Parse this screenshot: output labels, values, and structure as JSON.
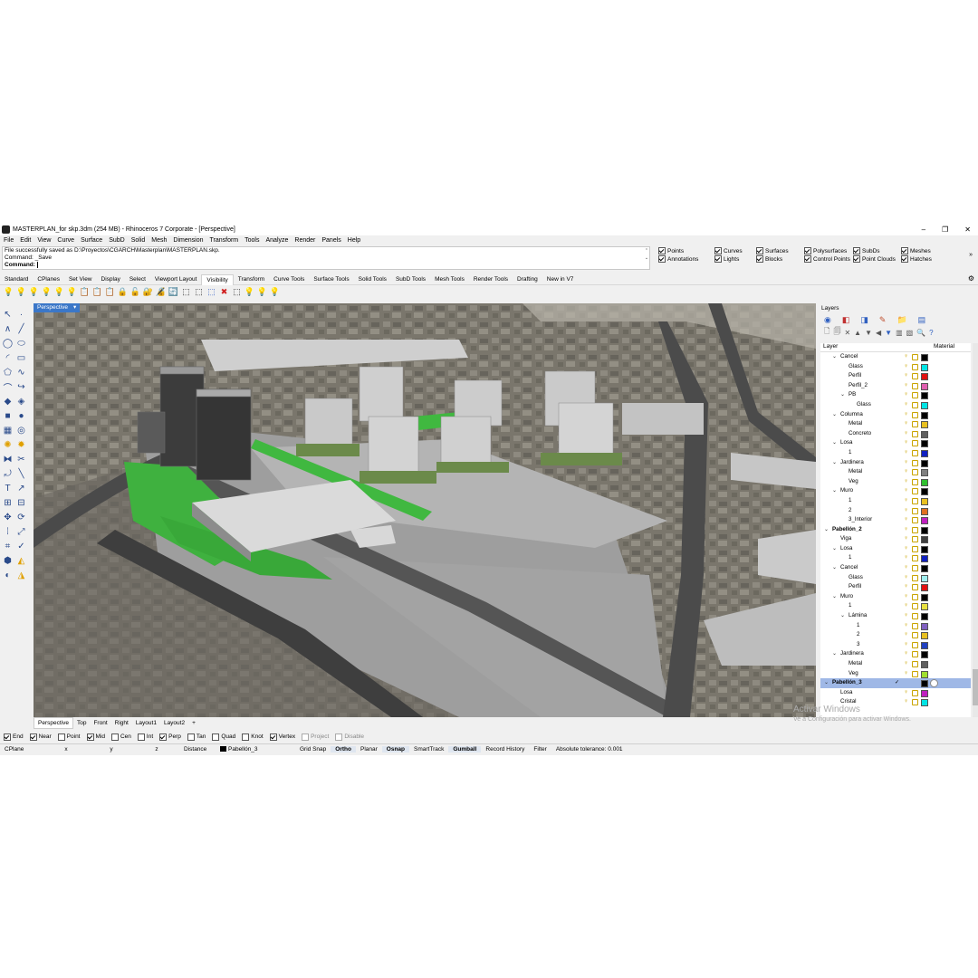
{
  "window": {
    "title": "MASTERPLAN_for skp.3dm (254 MB) - Rhinoceros 7 Corporate - [Perspective]",
    "minimize": "–",
    "maximize": "❐",
    "close": "✕"
  },
  "menu": [
    "File",
    "Edit",
    "View",
    "Curve",
    "Surface",
    "SubD",
    "Solid",
    "Mesh",
    "Dimension",
    "Transform",
    "Tools",
    "Analyze",
    "Render",
    "Panels",
    "Help"
  ],
  "command": {
    "line1": "File successfully saved as D:\\Proyectos\\CGARCH\\Masterplan\\MASTERPLAN.skp.",
    "line2": "Command: _Save",
    "prompt": "Command:"
  },
  "filters": [
    {
      "label": "Points",
      "checked": true
    },
    {
      "label": "Annotations",
      "checked": true
    },
    {
      "label": "Curves",
      "checked": true
    },
    {
      "label": "Lights",
      "checked": true
    },
    {
      "label": "Surfaces",
      "checked": true
    },
    {
      "label": "Blocks",
      "checked": true
    },
    {
      "label": "Polysurfaces",
      "checked": true
    },
    {
      "label": "Control Points",
      "checked": true
    },
    {
      "label": "SubDs",
      "checked": true
    },
    {
      "label": "Point Clouds",
      "checked": true
    },
    {
      "label": "Meshes",
      "checked": true
    },
    {
      "label": "Hatches",
      "checked": true
    }
  ],
  "toolbar_tabs": [
    "Standard",
    "CPlanes",
    "Set View",
    "Display",
    "Select",
    "Viewport Layout",
    "Visibility",
    "Transform",
    "Curve Tools",
    "Surface Tools",
    "Solid Tools",
    "SubD Tools",
    "Mesh Tools",
    "Render Tools",
    "Drafting",
    "New in V7"
  ],
  "active_tab": "Visibility",
  "viewport": {
    "label": "Perspective",
    "dropdown": "▾"
  },
  "viewport_tabs": [
    "Perspective",
    "Top",
    "Front",
    "Right",
    "Layout1",
    "Layout2",
    "+"
  ],
  "osnaps": [
    {
      "label": "End",
      "checked": true
    },
    {
      "label": "Near",
      "checked": true
    },
    {
      "label": "Point",
      "checked": false
    },
    {
      "label": "Mid",
      "checked": true
    },
    {
      "label": "Cen",
      "checked": false
    },
    {
      "label": "Int",
      "checked": false
    },
    {
      "label": "Perp",
      "checked": true
    },
    {
      "label": "Tan",
      "checked": false
    },
    {
      "label": "Quad",
      "checked": false
    },
    {
      "label": "Knot",
      "checked": false
    },
    {
      "label": "Vertex",
      "checked": true
    },
    {
      "label": "Project",
      "checked": false,
      "disabled": true
    },
    {
      "label": "Disable",
      "checked": false,
      "disabled": true
    }
  ],
  "status": {
    "cplane": "CPlane",
    "x": "x",
    "y": "y",
    "z": "z",
    "distance": "Distance",
    "layer": "Pabellón_3",
    "grid_snap": "Grid Snap",
    "ortho": "Ortho",
    "planar": "Planar",
    "osnap": "Osnap",
    "smarttrack": "SmartTrack",
    "gumball": "Gumball",
    "record_history": "Record History",
    "filter": "Filter",
    "tolerance": "Absolute tolerance: 0.001"
  },
  "layers_panel": {
    "title": "Layers",
    "col_layer": "Layer",
    "col_material": "Material",
    "rows": [
      {
        "name": "Cancel",
        "indent": 1,
        "exp": "v",
        "color": "#000000"
      },
      {
        "name": "Glass",
        "indent": 2,
        "exp": "",
        "color": "#00e5e5"
      },
      {
        "name": "Perfil",
        "indent": 2,
        "exp": "",
        "color": "#e01010"
      },
      {
        "name": "Perfil_2",
        "indent": 2,
        "exp": "",
        "color": "#e060b0"
      },
      {
        "name": "PB",
        "indent": 2,
        "exp": "v",
        "color": "#000000"
      },
      {
        "name": "Glass",
        "indent": 3,
        "exp": "",
        "color": "#00e5e5"
      },
      {
        "name": "Columna",
        "indent": 1,
        "exp": "v",
        "color": "#000000"
      },
      {
        "name": "Metal",
        "indent": 2,
        "exp": "",
        "color": "#e8c020"
      },
      {
        "name": "Concreto",
        "indent": 2,
        "exp": "",
        "color": "#606060"
      },
      {
        "name": "Losa",
        "indent": 1,
        "exp": "v",
        "color": "#000000"
      },
      {
        "name": "1",
        "indent": 2,
        "exp": "",
        "color": "#1020c0"
      },
      {
        "name": "Jardinera",
        "indent": 1,
        "exp": "v",
        "color": "#000000"
      },
      {
        "name": "Metal",
        "indent": 2,
        "exp": "",
        "color": "#808080"
      },
      {
        "name": "Veg",
        "indent": 2,
        "exp": "",
        "color": "#30c030"
      },
      {
        "name": "Muro",
        "indent": 1,
        "exp": "v",
        "color": "#000000"
      },
      {
        "name": "1",
        "indent": 2,
        "exp": "",
        "color": "#e8c020"
      },
      {
        "name": "2",
        "indent": 2,
        "exp": "",
        "color": "#e07020"
      },
      {
        "name": "3_Interior",
        "indent": 2,
        "exp": "",
        "color": "#c020c0"
      },
      {
        "name": "Pabellón_2",
        "indent": 0,
        "exp": "v",
        "color": "#000000"
      },
      {
        "name": "Viga",
        "indent": 1,
        "exp": "",
        "color": "#404040"
      },
      {
        "name": "Losa",
        "indent": 1,
        "exp": "v",
        "color": "#000000"
      },
      {
        "name": "1",
        "indent": 2,
        "exp": "",
        "color": "#1020c0"
      },
      {
        "name": "Cancel",
        "indent": 1,
        "exp": "v",
        "color": "#000000"
      },
      {
        "name": "Glass",
        "indent": 2,
        "exp": "",
        "color": "#a0f0f0"
      },
      {
        "name": "Perfil",
        "indent": 2,
        "exp": "",
        "color": "#e01010"
      },
      {
        "name": "Muro",
        "indent": 1,
        "exp": "v",
        "color": "#000000"
      },
      {
        "name": "1",
        "indent": 2,
        "exp": "",
        "color": "#e8e040"
      },
      {
        "name": "Lámina",
        "indent": 2,
        "exp": "v",
        "color": "#000000"
      },
      {
        "name": "1",
        "indent": 3,
        "exp": "",
        "color": "#8060c0"
      },
      {
        "name": "2",
        "indent": 3,
        "exp": "",
        "color": "#e8c020"
      },
      {
        "name": "3",
        "indent": 3,
        "exp": "",
        "color": "#2040c0"
      },
      {
        "name": "Jardinera",
        "indent": 1,
        "exp": "v",
        "color": "#000000"
      },
      {
        "name": "Metal",
        "indent": 2,
        "exp": "",
        "color": "#606060"
      },
      {
        "name": "Veg",
        "indent": 2,
        "exp": "",
        "color": "#a0e030"
      },
      {
        "name": "Pabellón_3",
        "indent": 0,
        "exp": "v",
        "color": "#000000",
        "selected": true
      },
      {
        "name": "Losa",
        "indent": 1,
        "exp": "",
        "color": "#c020c0"
      },
      {
        "name": "Cristal",
        "indent": 1,
        "exp": "",
        "color": "#00e5e5"
      }
    ]
  },
  "watermark": {
    "line1": "Activar Windows",
    "line2": "Ve a Configuración para activar Windows."
  },
  "colors": {
    "viewport_label_bg": "#3b77c8",
    "selected_layer_bg": "#9fb8e6"
  }
}
